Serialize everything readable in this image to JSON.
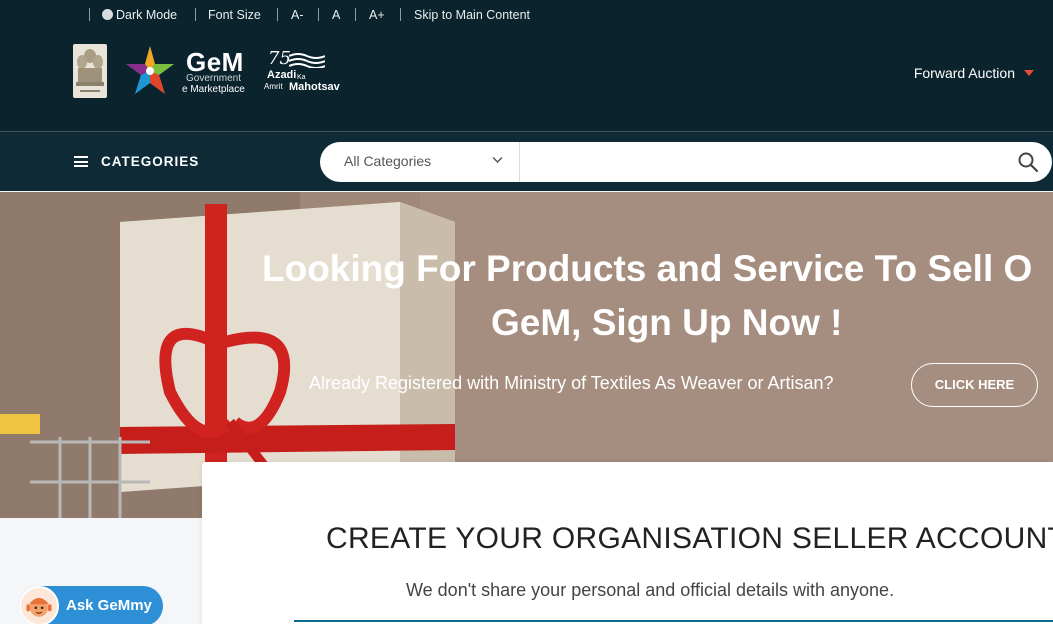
{
  "topbar": {
    "dark_mode": "Dark Mode",
    "font_size": "Font Size",
    "a_minus": "A-",
    "a": "A",
    "a_plus": "A+",
    "skip": "Skip to Main Content"
  },
  "brand": {
    "gem": "GeM",
    "gem_line1": "Government",
    "gem_line2": "e Marketplace",
    "azadi_75": "75",
    "azadi_text": "Azadi",
    "azadi_ka": "Ka",
    "azadi_amrit": "Amrit",
    "azadi_mahotsav": "Mahotsav"
  },
  "header": {
    "forward_auction": "Forward Auction"
  },
  "nav": {
    "categories_label": "CATEGORIES",
    "search_select_value": "All Categories",
    "search_placeholder": ""
  },
  "hero": {
    "title_line1": "Looking For Products and Service To Sell O",
    "title_line2": "GeM, Sign Up Now !",
    "subtitle": "Already Registered with Ministry of Textiles As Weaver or Artisan?",
    "cta": "CLICK HERE"
  },
  "card": {
    "title": "CREATE YOUR ORGANISATION SELLER ACCOUNT",
    "subtitle": "We don't share your personal and official details with anyone."
  },
  "chat": {
    "label": "Ask GeMmy"
  },
  "colors": {
    "header_bg": "#0b232d",
    "catbar_bg": "#0d2a36",
    "accent_red": "#e84b3a",
    "chat_blue": "#2d8fd5",
    "ribbon_red": "#d0231f"
  },
  "icons": {
    "menu": "hamburger-icon",
    "search": "search-icon",
    "dropdown": "chevron-down-icon",
    "caret": "caret-down-icon",
    "dark_mode": "circle-toggle-icon"
  }
}
